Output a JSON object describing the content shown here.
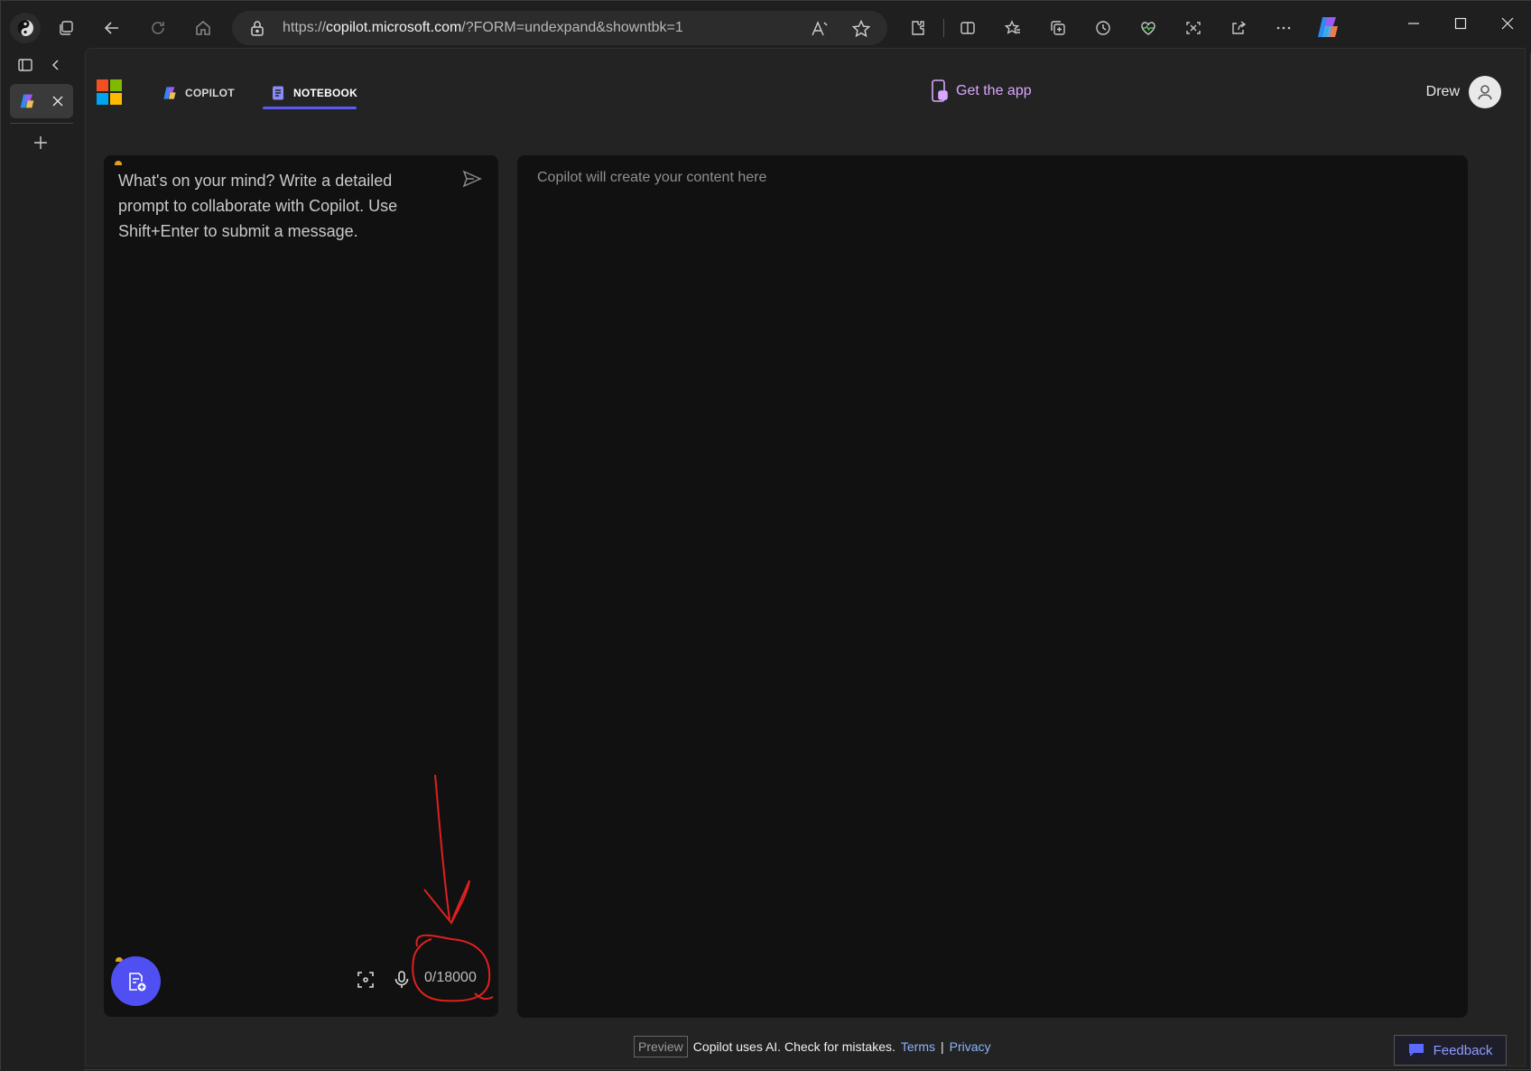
{
  "browser": {
    "url_prefix": "https://",
    "url_domain": "copilot.microsoft.com",
    "url_path": "/?FORM=undexpand&showntbk=1"
  },
  "nav": {
    "tabs": [
      {
        "label": "COPILOT"
      },
      {
        "label": "NOTEBOOK"
      }
    ],
    "get_app": "Get the app",
    "user_name": "Drew"
  },
  "editor": {
    "placeholder": "What's on your mind? Write a detailed prompt to collaborate with Copilot. Use Shift+Enter to submit a message.",
    "counter": "0/18000"
  },
  "content": {
    "placeholder": "Copilot will create your content here"
  },
  "footer": {
    "preview": "Preview",
    "disclaimer": "Copilot uses AI. Check for mistakes.",
    "terms": "Terms",
    "separator": "|",
    "privacy": "Privacy",
    "feedback": "Feedback"
  },
  "colors": {
    "accent": "#4f4ff2",
    "annotation": "#e0201e",
    "get_app": "#d9a6ff"
  }
}
